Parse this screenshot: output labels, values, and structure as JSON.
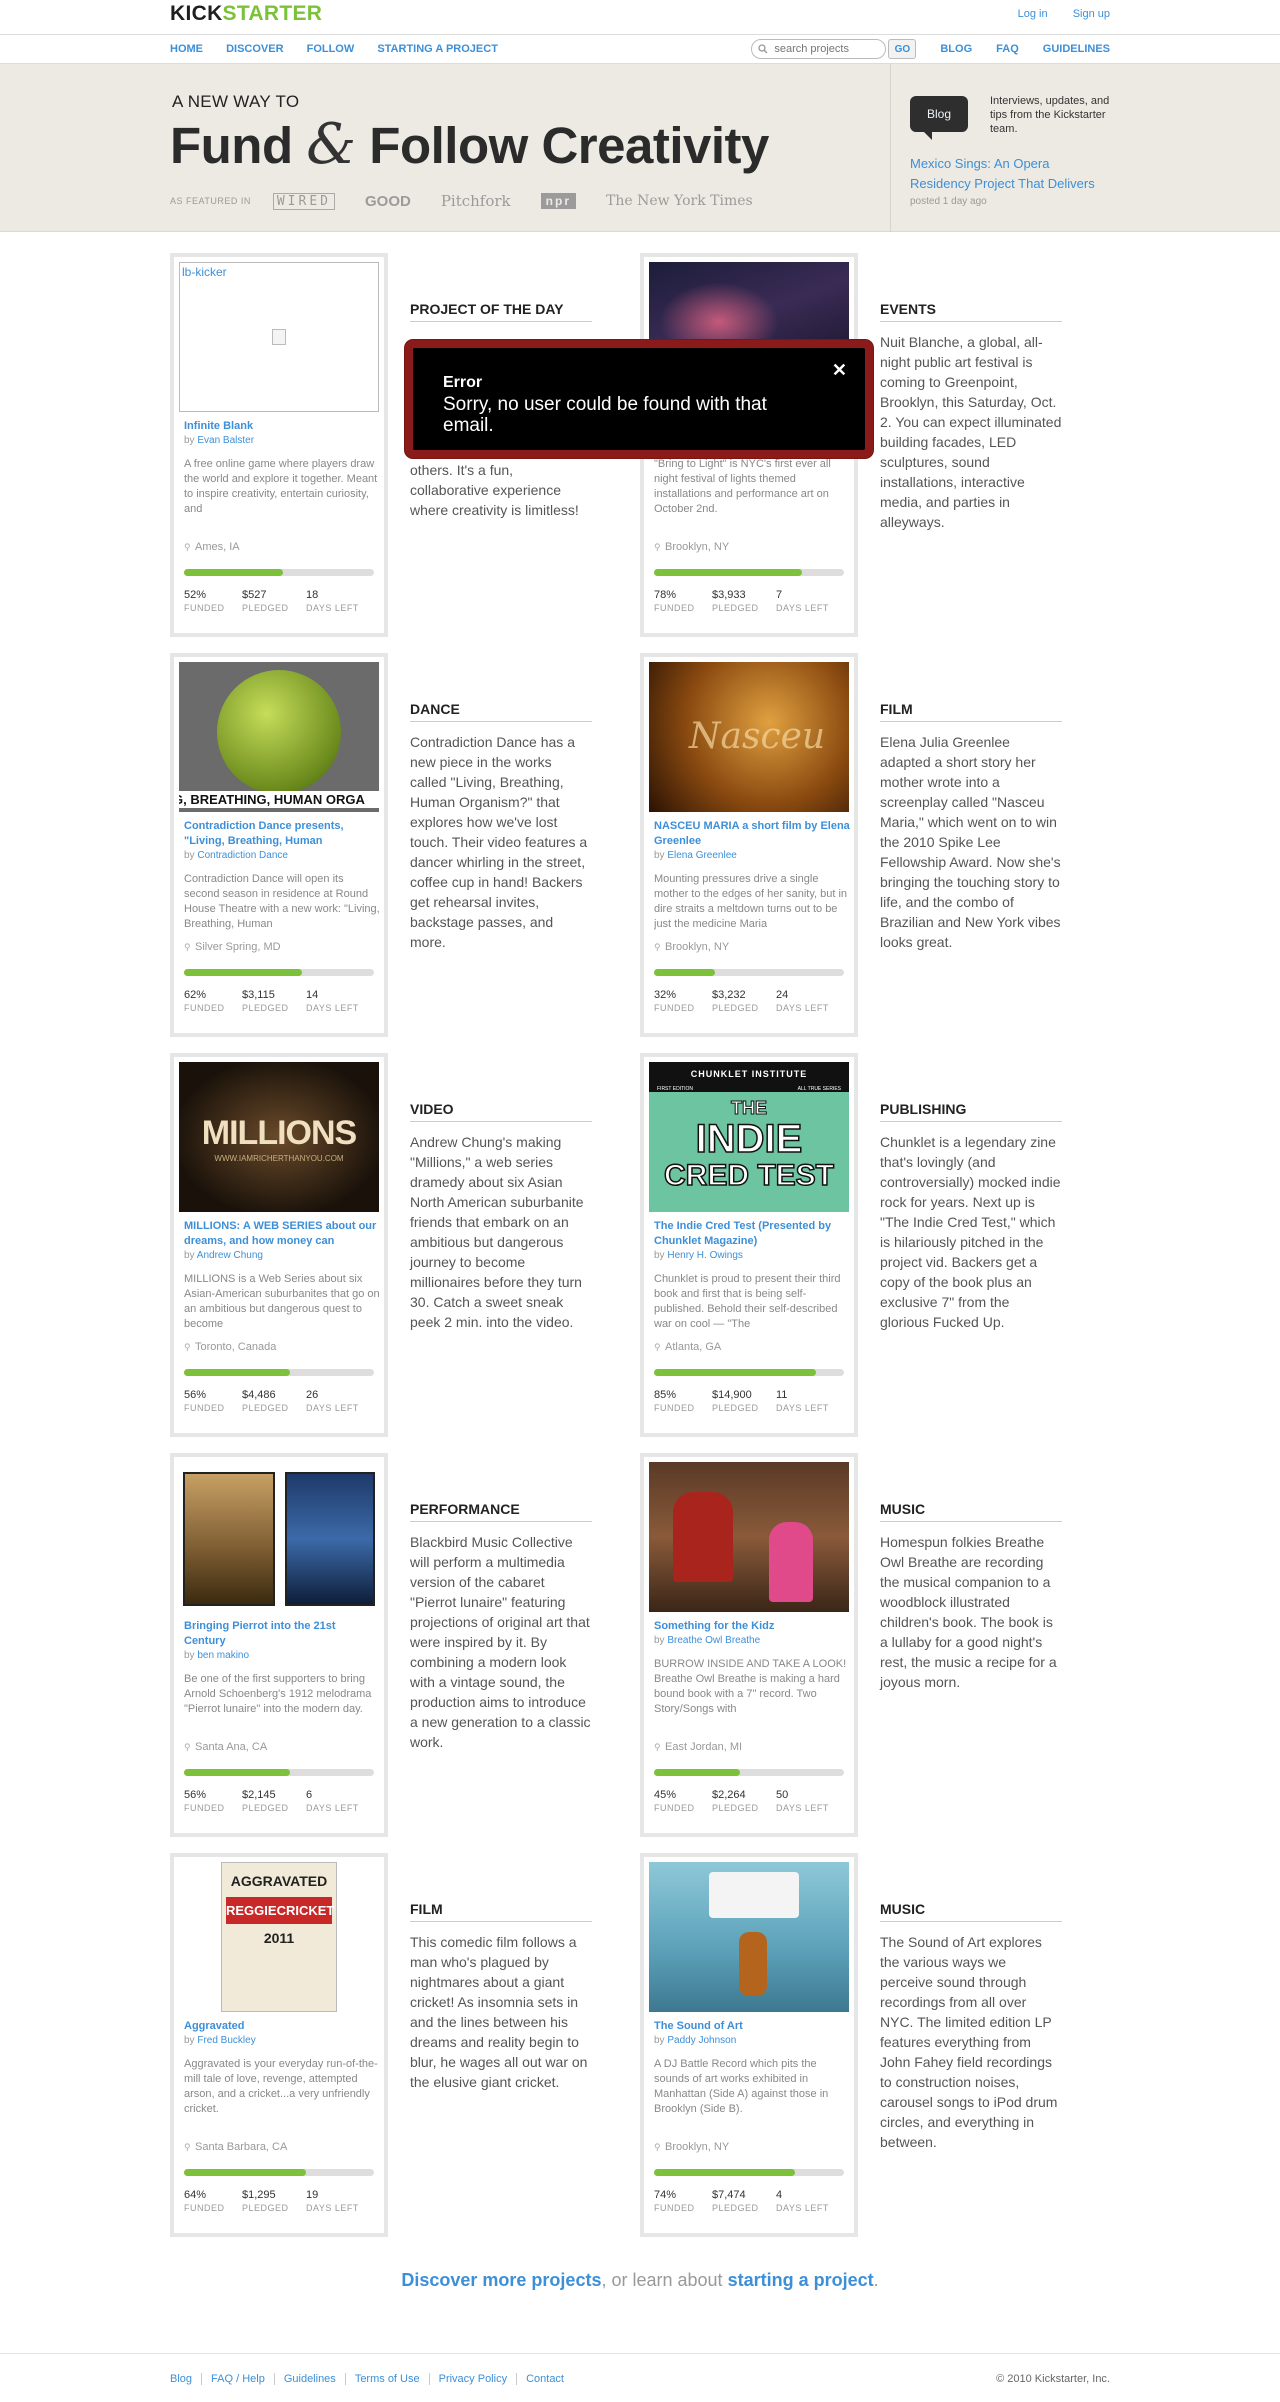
{
  "header": {
    "logo_part1": "KICK",
    "logo_part2": "STARTER",
    "login": "Log in",
    "signup": "Sign up"
  },
  "nav": {
    "home": "HOME",
    "discover": "DISCOVER",
    "follow": "FOLLOW",
    "starting": "STARTING A PROJECT",
    "search_placeholder": "search projects",
    "go": "GO",
    "blog": "BLOG",
    "faq": "FAQ",
    "guidelines": "GUIDELINES"
  },
  "hero": {
    "small": "A NEW WAY TO",
    "fund": "Fund ",
    "amp": "&",
    "rest": " Follow Creativity",
    "featured_label": "AS FEATURED IN",
    "pubs": [
      "WIRED",
      "GOOD",
      "Pitchfork",
      "npr",
      "The New York Times"
    ]
  },
  "blog": {
    "bubble": "Blog",
    "desc": "Interviews, updates, and tips from the Kickstarter team.",
    "post": "Mexico Sings: An Opera Residency Project That Delivers",
    "date": "posted 1 day ago"
  },
  "colors": {
    "link": "#3d8fd8",
    "progress": "#7dc13a",
    "modal_border": "#8b1a1a"
  },
  "projects": [
    {
      "title": "Infinite Blank",
      "by": "by",
      "author": "Evan Balster",
      "desc": "A free online game where players draw the world and explore it together. Meant to inspire creativity, entertain curiosity, and",
      "loc": "Ames, IA",
      "funded_pct": 52,
      "funded": "52%",
      "pledged": "$527",
      "days": "18",
      "img_alt": "lb-kicker",
      "side_cat": "PROJECT OF THE DAY",
      "side_text": "exploring the worlds of others. It's a fun, collaborative experience where creativity is limitless!"
    },
    {
      "title": "",
      "by": "by",
      "author": "",
      "desc": "\"Bring to Light\" is NYC's first ever all night festival of lights themed installations and performance art on October 2nd.",
      "loc": "Brooklyn, NY",
      "funded_pct": 78,
      "funded": "78%",
      "pledged": "$3,933",
      "days": "7",
      "side_cat": "EVENTS",
      "side_text": "Nuit Blanche, a global, all-night public art festival is coming to Greenpoint, Brooklyn, this Saturday, Oct. 2. You can expect illuminated building facades, LED sculptures, sound installations, interactive media, and parties in alleyways."
    },
    {
      "title": "Contradiction Dance presents, \"Living, Breathing, Human",
      "by": "by",
      "author": "Contradiction Dance",
      "desc": "Contradiction Dance will open its second season in residence at Round House Theatre with a new work: \"Living, Breathing, Human",
      "loc": "Silver Spring, MD",
      "funded_pct": 62,
      "funded": "62%",
      "pledged": "$3,115",
      "days": "14",
      "img_text": "G, BREATHING, HUMAN ORGA",
      "side_cat": "DANCE",
      "side_text": "Contradiction Dance has a new piece in the works called \"Living, Breathing, Human Organism?\" that explores how we've lost touch. Their video features a dancer whirling in the street, coffee cup in hand! Backers get rehearsal invites, backstage passes, and more."
    },
    {
      "title": "NASCEU MARIA a short film by Elena Greenlee",
      "by": "by",
      "author": "Elena Greenlee",
      "desc": "Mounting pressures drive a single mother to the edges of her sanity, but in dire straits a meltdown turns out to be just the medicine Maria",
      "loc": "Brooklyn, NY",
      "funded_pct": 32,
      "funded": "32%",
      "pledged": "$3,232",
      "days": "24",
      "img_text": "Nasceu",
      "side_cat": "FILM",
      "side_text": "Elena Julia Greenlee adapted a short story her mother wrote into a screenplay called \"Nasceu Maria,\" which went on to win the 2010 Spike Lee Fellowship Award. Now she's bringing the touching story to life, and the combo of Brazilian and New York vibes looks great."
    },
    {
      "title": "MILLIONS: A WEB SERIES about our dreams, and how money can",
      "by": "by",
      "author": "Andrew Chung",
      "desc": "MILLIONS is a Web Series about six Asian-American suburbanites that go on an ambitious but dangerous quest to become",
      "loc": "Toronto, Canada",
      "funded_pct": 56,
      "funded": "56%",
      "pledged": "$4,486",
      "days": "26",
      "img_text": "MILLIONS",
      "img_sub": "WWW.IAMRICHERTHANYOU.COM",
      "side_cat": "VIDEO",
      "side_text": "Andrew Chung's making \"Millions,\" a web series dramedy about six Asian North American suburbanite friends that embark on an ambitious but dangerous journey to become millionaires before they turn 30. Catch a sweet sneak peek 2 min. into the video."
    },
    {
      "title": "The Indie Cred Test (Presented by Chunklet Magazine)",
      "by": "by",
      "author": "Henry H. Owings",
      "desc": "Chunklet is proud to present their third book and first that is being self-published. Behold their self-described war on cool — \"The",
      "loc": "Atlanta, GA",
      "funded_pct": 85,
      "funded": "85%",
      "pledged": "$14,900",
      "days": "11",
      "img_top": "CHUNKLET INSTITUTE",
      "img_l": "FIRST EDITION",
      "img_r": "ALL TRUE SERIES",
      "img_text1": "THE",
      "img_text2": "INDIE",
      "img_text3": "CRED TEST",
      "side_cat": "PUBLISHING",
      "side_text": "Chunklet is a legendary zine that's lovingly (and controversially) mocked indie rock for years. Next up is \"The Indie Cred Test,\" which is hilariously pitched in the project vid. Backers get a copy of the book plus an exclusive 7\" from the glorious Fucked Up."
    },
    {
      "title": "Bringing Pierrot into the 21st Century",
      "by": "by",
      "author": "ben makino",
      "desc": "Be one of the first supporters to bring Arnold Schoenberg's 1912 melodrama \"Pierrot lunaire\" into the modern day.",
      "loc": "Santa Ana, CA",
      "funded_pct": 56,
      "funded": "56%",
      "pledged": "$2,145",
      "days": "6",
      "side_cat": "PERFORMANCE",
      "side_text": "Blackbird Music Collective will perform a multimedia version of the cabaret \"Pierrot lunaire\" featuring projections of original art that were inspired by it. By combining a modern look with a vintage sound, the production aims to introduce a new generation to a classic work."
    },
    {
      "title": "Something for the Kidz",
      "by": "by",
      "author": "Breathe Owl Breathe",
      "desc": "BURROW INSIDE AND TAKE A LOOK! Breathe Owl Breathe is making a hard bound book with a 7\" record. Two Story/Songs with",
      "loc": "East Jordan, MI",
      "funded_pct": 45,
      "funded": "45%",
      "pledged": "$2,264",
      "days": "50",
      "side_cat": "MUSIC",
      "side_text": "Homespun folkies Breathe Owl Breathe are recording the musical companion to a woodblock illustrated children's book. The book is a lullaby for a good night's rest, the music a recipe for a joyous morn."
    },
    {
      "title": "Aggravated",
      "by": "by",
      "author": "Fred Buckley",
      "desc": "Aggravated is your everyday run-of-the-mill tale of love, revenge, attempted arson, and a cricket...a very unfriendly cricket.",
      "loc": "Santa Barbara, CA",
      "funded_pct": 64,
      "funded": "64%",
      "pledged": "$1,295",
      "days": "19",
      "img_text": "AGGRAVATED",
      "img_l": "REGGIE",
      "img_r": "CRICKET",
      "img_year": "2011",
      "side_cat": "FILM",
      "side_text": "This comedic film follows a man who's plagued by nightmares about a giant cricket! As insomnia sets in and the lines between his dreams and reality begin to blur, he wages all out war on the elusive giant cricket."
    },
    {
      "title": "The Sound of Art",
      "by": "by",
      "author": "Paddy Johnson",
      "desc": "A DJ Battle Record which pits the sounds of art works exhibited in Manhattan (Side A) against those in Brooklyn (Side B).",
      "loc": "Brooklyn, NY",
      "funded_pct": 74,
      "funded": "74%",
      "pledged": "$7,474",
      "days": "4",
      "side_cat": "MUSIC",
      "side_text": "The Sound of Art explores the various ways we perceive sound through recordings from all over NYC. The limited edition LP features everything from John Fahey field recordings to construction noises, carousel songs to iPod drum circles, and everything in between."
    }
  ],
  "stat_labels": {
    "funded": "FUNDED",
    "pledged": "PLEDGED",
    "days": "DAYS LEFT"
  },
  "discover": {
    "link1": "Discover more projects",
    "mid": ", or learn about ",
    "link2": "starting a project",
    "end": "."
  },
  "footer": {
    "links": [
      "Blog",
      "FAQ / Help",
      "Guidelines",
      "Terms of Use",
      "Privacy Policy",
      "Contact"
    ],
    "copyright": "© 2010 Kickstarter, Inc."
  },
  "modal": {
    "title": "Error",
    "message": "Sorry, no user could be found with that email.",
    "close": "✕"
  }
}
